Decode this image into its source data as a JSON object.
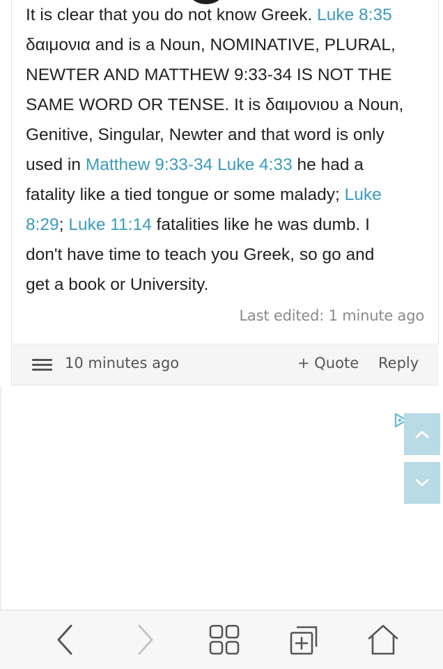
{
  "post": {
    "lines": [
      [
        {
          "t": "It is clear that you do not know Greek. "
        },
        {
          "t": "Luke 8:35",
          "link": true
        }
      ],
      [
        {
          "t": "δαιμονια and is a Noun, NOMINATIVE, PLURAL,"
        }
      ],
      [
        {
          "t": "NEWTER AND MATTHEW 9:33-34 IS NOT THE"
        }
      ],
      [
        {
          "t": "SAME WORD OR TENSE. It is δαιμονιου a Noun,"
        }
      ],
      [
        {
          "t": "Genitive, Singular, Newter and that word is only"
        }
      ],
      [
        {
          "t": "used in "
        },
        {
          "t": "Matthew 9:33-34",
          "link": true
        },
        {
          "t": " "
        },
        {
          "t": "Luke 4:33",
          "link": true
        },
        {
          "t": " he had a"
        }
      ],
      [
        {
          "t": "fatality like a tied tongue or some malady; "
        },
        {
          "t": "Luke",
          "link": true
        }
      ],
      [
        {
          "t": "8:29",
          "link": true
        },
        {
          "t": "; "
        },
        {
          "t": "Luke 11:14",
          "link": true
        },
        {
          "t": " fatalities like he was dumb. I"
        }
      ],
      [
        {
          "t": "don't have time to teach you Greek, so go and"
        }
      ],
      [
        {
          "t": "get a book or University."
        }
      ]
    ],
    "last_edited": "Last edited: 1 minute ago"
  },
  "footer": {
    "menu_icon": "hamburger-icon",
    "timestamp": "10 minutes ago",
    "quote_label": "+ Quote",
    "reply_label": "Reply"
  },
  "scroll": {
    "up_icon": "chevron-up-icon",
    "down_icon": "chevron-down-icon"
  },
  "browser_nav": {
    "icons": [
      "back-arrow-icon",
      "forward-arrow-icon",
      "tabs-grid-icon",
      "new-tab-icon",
      "home-icon"
    ]
  },
  "colors": {
    "link": "#3a9bbd",
    "text": "#222222",
    "muted": "#8a8a8a",
    "scroll_button": "#b8dbe6",
    "footer_bg": "#f5f5f5"
  }
}
